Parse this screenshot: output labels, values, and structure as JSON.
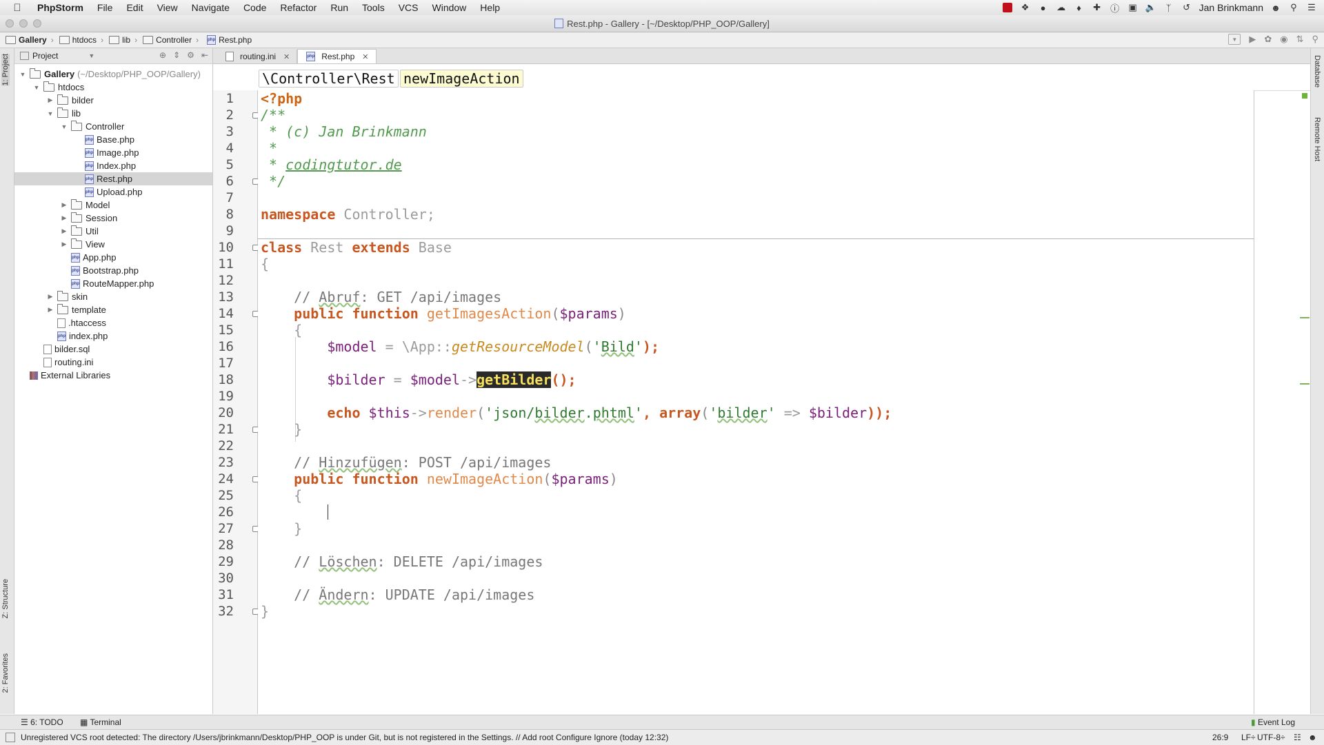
{
  "menubar": {
    "app_name": "PhpStorm",
    "items": [
      "File",
      "Edit",
      "View",
      "Navigate",
      "Code",
      "Refactor",
      "Run",
      "Tools",
      "VCS",
      "Window",
      "Help"
    ],
    "user_name": "Jan Brinkmann"
  },
  "window": {
    "title": "Rest.php - Gallery - [~/Desktop/PHP_OOP/Gallery]"
  },
  "navbar": {
    "crumbs": [
      "Gallery",
      "htdocs",
      "lib",
      "Controller",
      "Rest.php"
    ]
  },
  "left_strip": {
    "project_tab": "1: Project",
    "structure_tab": "Z: Structure",
    "favorites_tab": "2: Favorites"
  },
  "project_panel": {
    "header": "Project",
    "tree": [
      {
        "label": "Gallery",
        "extra": "(~/Desktop/PHP_OOP/Gallery)",
        "type": "folder",
        "depth": 0,
        "expanded": true
      },
      {
        "label": "htdocs",
        "type": "folder",
        "depth": 1,
        "expanded": true
      },
      {
        "label": "bilder",
        "type": "folder",
        "depth": 2,
        "expanded": false
      },
      {
        "label": "lib",
        "type": "folder",
        "depth": 2,
        "expanded": true
      },
      {
        "label": "Controller",
        "type": "folder",
        "depth": 3,
        "expanded": true
      },
      {
        "label": "Base.php",
        "type": "php",
        "depth": 4
      },
      {
        "label": "Image.php",
        "type": "php",
        "depth": 4
      },
      {
        "label": "Index.php",
        "type": "php",
        "depth": 4
      },
      {
        "label": "Rest.php",
        "type": "php",
        "depth": 4,
        "selected": true
      },
      {
        "label": "Upload.php",
        "type": "php",
        "depth": 4
      },
      {
        "label": "Model",
        "type": "folder",
        "depth": 3,
        "expanded": false
      },
      {
        "label": "Session",
        "type": "folder",
        "depth": 3,
        "expanded": false
      },
      {
        "label": "Util",
        "type": "folder",
        "depth": 3,
        "expanded": false
      },
      {
        "label": "View",
        "type": "folder",
        "depth": 3,
        "expanded": false
      },
      {
        "label": "App.php",
        "type": "php",
        "depth": 3
      },
      {
        "label": "Bootstrap.php",
        "type": "php",
        "depth": 3
      },
      {
        "label": "RouteMapper.php",
        "type": "php",
        "depth": 3
      },
      {
        "label": "skin",
        "type": "folder",
        "depth": 2,
        "expanded": false
      },
      {
        "label": "template",
        "type": "folder",
        "depth": 2,
        "expanded": false
      },
      {
        "label": ".htaccess",
        "type": "file",
        "depth": 2
      },
      {
        "label": "index.php",
        "type": "php",
        "depth": 2
      },
      {
        "label": "bilder.sql",
        "type": "file",
        "depth": 1
      },
      {
        "label": "routing.ini",
        "type": "file",
        "depth": 1
      },
      {
        "label": "External Libraries",
        "type": "lib",
        "depth": 0
      }
    ]
  },
  "editor": {
    "tabs": [
      {
        "label": "routing.ini",
        "active": false
      },
      {
        "label": "Rest.php",
        "active": true
      }
    ],
    "crumbs": [
      "\\Controller\\Rest",
      "newImageAction"
    ],
    "line_numbers": [
      "1",
      "2",
      "3",
      "4",
      "5",
      "6",
      "7",
      "8",
      "9",
      "10",
      "11",
      "12",
      "13",
      "14",
      "15",
      "16",
      "17",
      "18",
      "19",
      "20",
      "21",
      "22",
      "23",
      "24",
      "25",
      "26",
      "27",
      "28",
      "29",
      "30",
      "31",
      "32"
    ],
    "code": {
      "l1": "<?php",
      "l2": "/**",
      "l3": " * (c) Jan Brinkmann",
      "l4": " *",
      "l5_star": " * ",
      "l5_link": "codingtutor.de",
      "l6": " */",
      "l8_kw": "namespace",
      "l8_rest": " Controller;",
      "l10_kw1": "class",
      "l10_name": " Rest ",
      "l10_kw2": "extends",
      "l10_base": " Base",
      "l11": "{",
      "l13_a": "    // ",
      "l13_b": "Abruf",
      "l13_c": ": GET /api/images",
      "l14_indent": "    ",
      "l14_kw": "public function",
      "l14_fn": " getImagesAction",
      "l14_p1": "(",
      "l14_var": "$params",
      "l14_p2": ")",
      "l15": "    {",
      "l16_indent": "        ",
      "l16_var": "$model",
      "l16_eq": " = \\App::",
      "l16_fn": "getResourceModel",
      "l16_p1": "(",
      "l16_str_a": "'",
      "l16_str_b": "Bild",
      "l16_str_c": "'",
      "l16_p2": ");",
      "l18_indent": "        ",
      "l18_var1": "$bilder",
      "l18_eq": " = ",
      "l18_var2": "$model",
      "l18_arrow": "->",
      "l18_fn": "getBilder",
      "l18_end": "();",
      "l20_indent": "        ",
      "l20_kw": "echo",
      "l20_sp": " ",
      "l20_this": "$this",
      "l20_arrow": "->",
      "l20_fn": "render",
      "l20_p1": "(",
      "l20_str1a": "'json/",
      "l20_str1b": "bilder",
      "l20_str1c": ".",
      "l20_str1d": "phtml",
      "l20_str1e": "'",
      "l20_comma": ", ",
      "l20_kw2": "array",
      "l20_p2": "(",
      "l20_str2a": "'",
      "l20_str2b": "bilder",
      "l20_str2c": "'",
      "l20_dbl": " => ",
      "l20_var": "$bilder",
      "l20_end": "));",
      "l21": "    }",
      "l23_a": "    // ",
      "l23_b": "Hinzufügen",
      "l23_c": ": POST /api/images",
      "l24_indent": "    ",
      "l24_kw": "public function",
      "l24_fn": " newImageAction",
      "l24_p1": "(",
      "l24_var": "$params",
      "l24_p2": ")",
      "l25": "    {",
      "l27": "    }",
      "l29_a": "    // ",
      "l29_b": "Löschen",
      "l29_c": ": DELETE /api/images",
      "l31_a": "    // ",
      "l31_b": "Ändern",
      "l31_c": ": UPDATE /api/images",
      "l32": "}"
    }
  },
  "right_strip": {
    "database_tab": "Database",
    "remote_host_tab": "Remote Host"
  },
  "bottom_tools": {
    "todo": "6: TODO",
    "terminal": "Terminal",
    "event_log": "Event Log"
  },
  "status": {
    "message": "Unregistered VCS root detected: The directory /Users/jbrinkmann/Desktop/PHP_OOP is under Git, but is not registered in the Settings. // Add root  Configure  Ignore (today 12:32)",
    "position": "26:9",
    "line_sep": "LF÷",
    "encoding": "UTF-8÷"
  },
  "colors": {
    "accent_green": "#7eb35a",
    "keyword": "#000080",
    "doc_comment": "#529b4e",
    "highlight_bg": "#2a2a2a"
  },
  "icons": [
    "apple-icon",
    "search-icon",
    "run-icon",
    "debug-icon",
    "folder-icon",
    "php-file-icon",
    "close-icon"
  ]
}
